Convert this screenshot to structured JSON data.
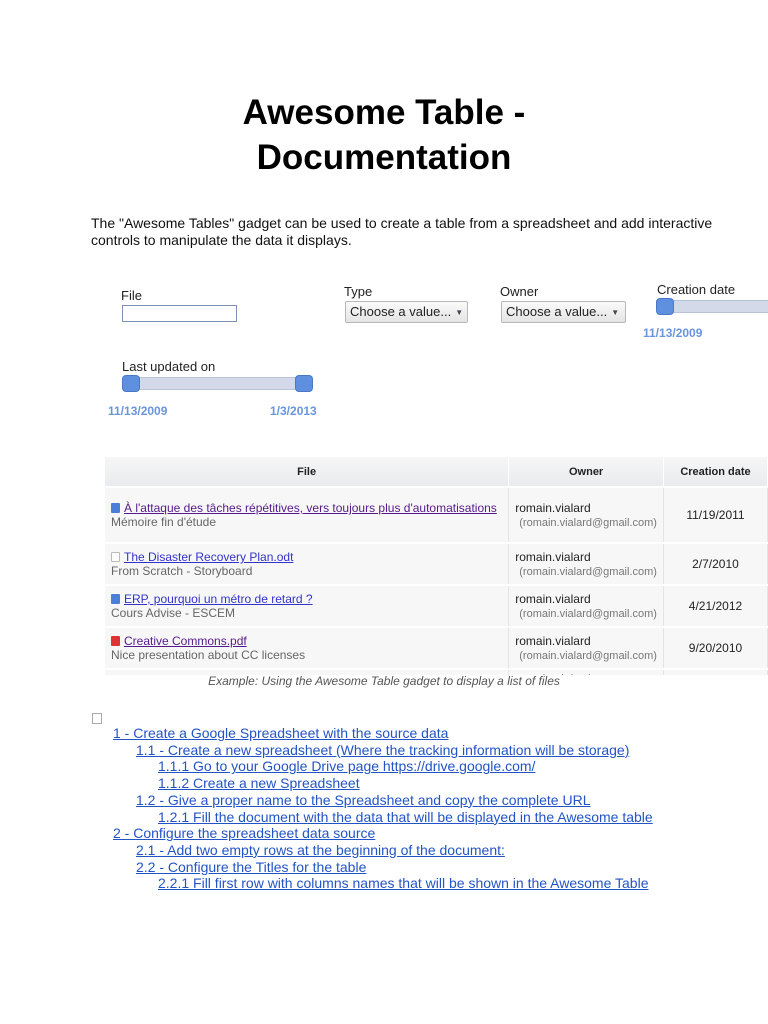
{
  "title_line1": "Awesome Table -",
  "title_line2": "Documentation",
  "intro": "The \"Awesome Tables\" gadget can be used to create a table from a spreadsheet and add interactive controls to manipulate the data it displays.",
  "filters": {
    "file_label": "File",
    "file_value": "",
    "type_label": "Type",
    "type_value": "Choose a value...",
    "owner_label": "Owner",
    "owner_value": "Choose a value...",
    "creation_label": "Creation date",
    "creation_start": "11/13/2009",
    "updated_label": "Last updated on",
    "updated_start": "11/13/2009",
    "updated_end": "1/3/2013"
  },
  "table": {
    "headers": [
      "File",
      "Owner",
      "Creation date"
    ],
    "rows": [
      {
        "icon": "document-icon",
        "file": "À l'attaque des tâches répétitives, vers toujours plus d'automatisations",
        "desc": "Mémoire fin d'étude",
        "owner": "romain.vialard",
        "email": "(romain.vialard@gmail.com)",
        "date": "11/19/2011"
      },
      {
        "icon": "blank-file-icon",
        "file": "The Disaster Recovery Plan.odt",
        "desc": "From Scratch - Storyboard",
        "owner": "romain.vialard",
        "email": "(romain.vialard@gmail.com)",
        "date": "2/7/2010"
      },
      {
        "icon": "document-icon",
        "file": "ERP, pourquoi un métro de retard ?",
        "desc": "Cours Advise - ESCEM",
        "owner": "romain.vialard",
        "email": "(romain.vialard@gmail.com)",
        "date": "4/21/2012"
      },
      {
        "icon": "pdf-icon",
        "file": "Creative Commons.pdf",
        "desc": "Nice presentation about CC licenses",
        "owner": "romain.vialard",
        "email": "(romain.vialard@gmail.com)",
        "date": "9/20/2010"
      }
    ],
    "partial_owner": "romain.vialard"
  },
  "caption": "Example: Using the Awesome Table gadget to display a list of files",
  "toc": [
    "1 - Create a Google Spreadsheet with the source data",
    "1.1 - Create a new spreadsheet (Where the tracking information will be storage)",
    "1.1.1 Go to your Google Drive page https://drive.google.com/",
    "1.1.2 Create a new Spreadsheet",
    "1.2 - Give a proper name to the Spreadsheet and copy the complete URL",
    "1.2.1 Fill the document with the data that will be displayed in the Awesome table",
    "2 - Configure the spreadsheet data source",
    "2.1 - Add two empty rows at the beginning of the document:",
    "2.2 - Configure the Titles for the table",
    "2.2.1 Fill first row with columns names that will be shown in the Awesome Table"
  ]
}
